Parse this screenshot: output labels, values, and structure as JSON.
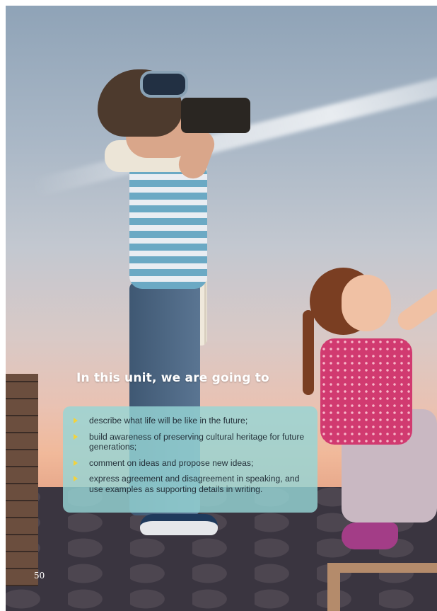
{
  "heading": "In this unit, we are going to",
  "objectives": [
    "describe what life will be like in the future;",
    "build awareness of preserving cultural heritage for future generations;",
    "comment on ideas and propose new ideas;",
    "express agreement and disagreement in speaking, and use examples as supporting details in writing."
  ],
  "page_number": "50",
  "colors": {
    "objective_box": "#96d6d6",
    "bullet": "#f2d33c",
    "heading": "#ffffff"
  }
}
